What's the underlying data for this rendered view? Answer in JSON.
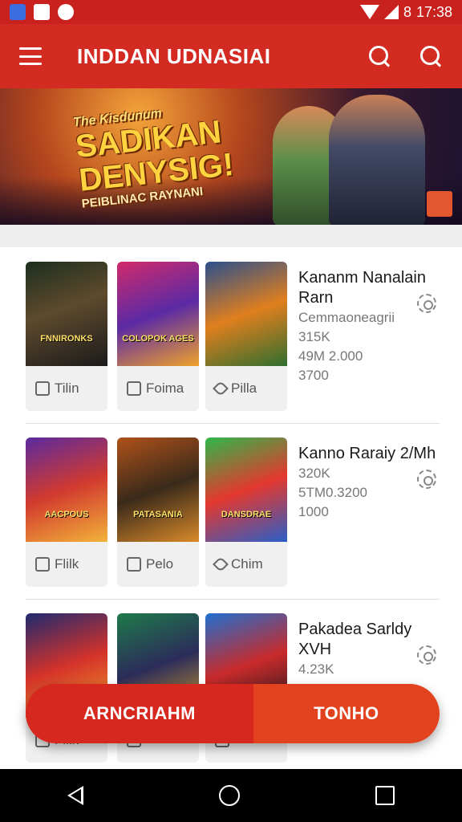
{
  "status_bar": {
    "time": "17:38",
    "battery_glyph": "8"
  },
  "app_bar": {
    "title": "INDDAN UDNASIAI"
  },
  "banner": {
    "kicker": "The Kisdunum",
    "line1": "SADIKAN",
    "line2": "DENYSIG!",
    "sub": "PEIBLINAC RAYNANI"
  },
  "rows": [
    {
      "cards": [
        {
          "art_text": "FNNIRONKS",
          "meta": "Tilin",
          "icon": "edit-icon"
        },
        {
          "art_text": "COLOPOK AGES",
          "meta": "Foima",
          "icon": "edit-icon"
        },
        {
          "art_text": "",
          "meta": "Pilla",
          "icon": "share-icon"
        }
      ],
      "info": {
        "title": "Kananm Nanalain Rarn",
        "line1": "Cemmaoneagrii",
        "line2": "315K",
        "line3": "49M 2.000",
        "line4": "3700"
      }
    },
    {
      "cards": [
        {
          "art_text": "AACPOUS",
          "meta": "Flilk",
          "icon": "edit-icon"
        },
        {
          "art_text": "PATASANIA",
          "meta": "Pelo",
          "icon": "edit-icon"
        },
        {
          "art_text": "DANSDRAE",
          "meta": "Chim",
          "icon": "pen-icon"
        }
      ],
      "info": {
        "title": "Kanno Raraiy 2/Mh",
        "line1": "320K",
        "line2": "5TM0.3200",
        "line3": "1000"
      }
    },
    {
      "cards": [
        {
          "art_text": "",
          "meta": "Flilk",
          "icon": "edit-icon"
        },
        {
          "art_text": "",
          "meta": "",
          "icon": "edit-icon"
        },
        {
          "art_text": "",
          "meta": "",
          "icon": "edit-icon"
        }
      ],
      "info": {
        "title": "Pakadea Sarldy XVH",
        "line1": "4.23K"
      }
    }
  ],
  "float_bar": {
    "left_label": "ARNCRIAHM",
    "right_label": "TONHO"
  },
  "colors": {
    "primary": "#d32a22",
    "accent": "#e3421f"
  }
}
